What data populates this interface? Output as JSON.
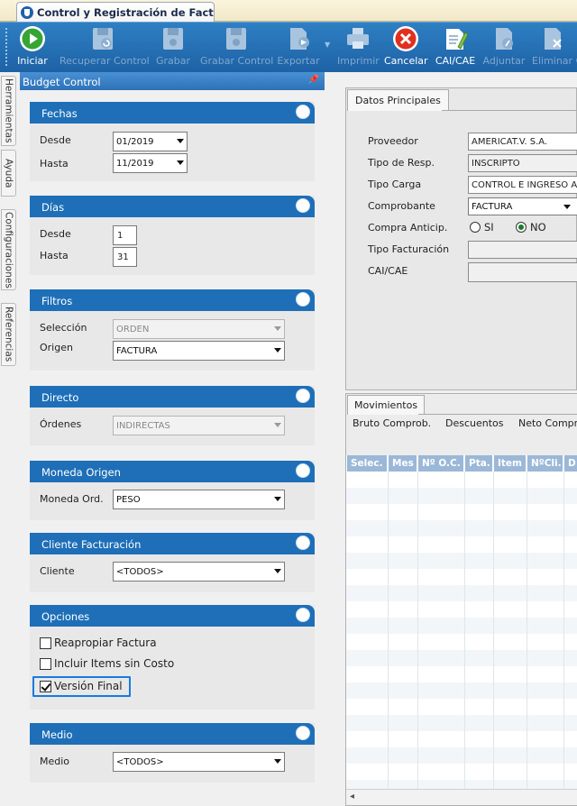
{
  "document_tab": {
    "title": "Control y Registración de Factura..."
  },
  "toolbar": {
    "buttons": [
      {
        "label": "Iniciar",
        "icon": "play-icon",
        "enabled": true
      },
      {
        "label": "Recuperar Control",
        "icon": "recover-disk-icon",
        "enabled": false
      },
      {
        "label": "Grabar",
        "icon": "save-disk-icon",
        "enabled": false
      },
      {
        "label": "Grabar Control",
        "icon": "save-control-disk-icon",
        "enabled": false
      },
      {
        "label": "Exportar",
        "icon": "export-icon",
        "enabled": false
      },
      {
        "label": "Imprimir",
        "icon": "printer-icon",
        "enabled": false
      },
      {
        "label": "Cancelar",
        "icon": "cancel-icon",
        "enabled": true
      },
      {
        "label": "CAI/CAE",
        "icon": "document-pencil-icon",
        "enabled": true
      },
      {
        "label": "Adjuntar",
        "icon": "attach-icon",
        "enabled": false
      },
      {
        "label": "Eliminar C",
        "icon": "delete-icon",
        "enabled": false
      }
    ]
  },
  "side_tabs": [
    "Herramientas",
    "Ayuda",
    "Configuraciones",
    "Referencias"
  ],
  "panel": {
    "title": "Budget Control",
    "fechas": {
      "title": "Fechas",
      "desde_label": "Desde",
      "desde_value": "01/2019",
      "hasta_label": "Hasta",
      "hasta_value": "11/2019"
    },
    "dias": {
      "title": "Días",
      "desde_label": "Desde",
      "desde_value": "1",
      "hasta_label": "Hasta",
      "hasta_value": "31"
    },
    "filtros": {
      "title": "Filtros",
      "seleccion_label": "Selección",
      "seleccion_value": "ORDEN",
      "origen_label": "Origen",
      "origen_value": "FACTURA"
    },
    "directo": {
      "title": "Directo",
      "ordenes_label": "Órdenes",
      "ordenes_value": "INDIRECTAS"
    },
    "moneda": {
      "title": "Moneda Origen",
      "label": "Moneda Ord.",
      "value": "PESO"
    },
    "cliente": {
      "title": "Cliente Facturación",
      "label": "Cliente",
      "value": "<TODOS>"
    },
    "opciones": {
      "title": "Opciones",
      "items": [
        {
          "label": "Reapropiar Factura",
          "checked": false
        },
        {
          "label": "Incluir Items sin Costo",
          "checked": false
        },
        {
          "label": "Versión Final",
          "checked": true
        }
      ]
    },
    "medio": {
      "title": "Medio",
      "label": "Medio",
      "value": "<TODOS>"
    }
  },
  "datos": {
    "tab": "Datos Principales",
    "fields": {
      "proveedor_label": "Proveedor",
      "proveedor_value": "AMERICAT.V. S.A.",
      "tipo_resp_label": "Tipo de Resp.",
      "tipo_resp_value": "INSCRIPTO",
      "tipo_carga_label": "Tipo Carga",
      "tipo_carga_value": "CONTROL E INGRESO AUT",
      "comprobante_label": "Comprobante",
      "comprobante_value": "FACTURA",
      "compra_label": "Compra Anticip.",
      "si_label": "SI",
      "no_label": "NO",
      "tipo_fact_label": "Tipo Facturación",
      "tipo_fact_value": "",
      "cai_label": "CAI/CAE",
      "cai_value": ""
    }
  },
  "movimientos": {
    "tab": "Movimientos",
    "summary": [
      "Bruto Comprob.",
      "Descuentos",
      "Neto Compro"
    ],
    "columns": [
      "Selec.",
      "Mes",
      "Nº O.C.",
      "Pta.",
      "Item",
      "NºCli.",
      "D"
    ]
  }
}
